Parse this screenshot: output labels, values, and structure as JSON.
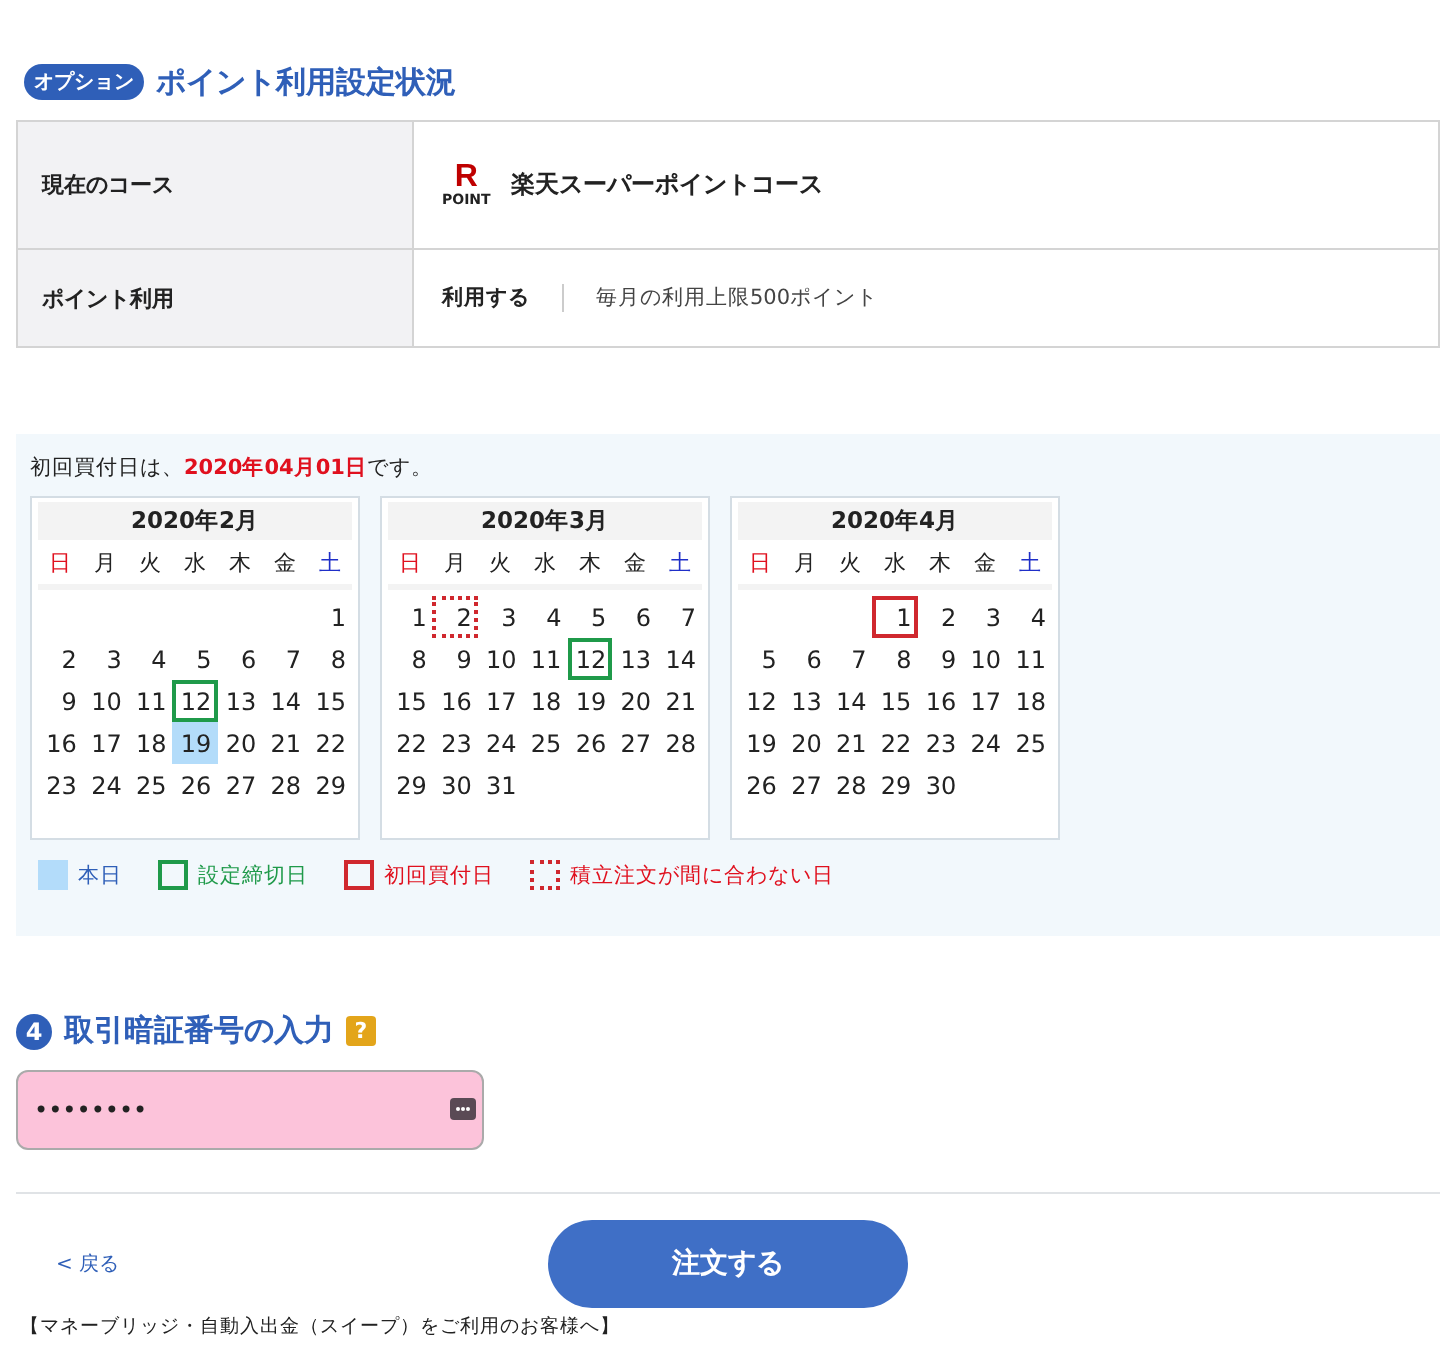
{
  "section_title": {
    "badge": "オプション",
    "title": "ポイント利用設定状況"
  },
  "settings_table": [
    {
      "label": "現在のコース",
      "kind": "course",
      "logo_text": "POINT",
      "logo_letter": "R",
      "value": "楽天スーパーポイントコース"
    },
    {
      "label": "ポイント利用",
      "kind": "usage",
      "value": "利用する",
      "note": "毎月の利用上限500ポイント"
    }
  ],
  "calendar_panel": {
    "intro": "初回買付日は、**2020年04月01日**です。",
    "months": [
      {
        "title": "2020年2月",
        "weekdays": [
          "日",
          "月",
          "火",
          "水",
          "木",
          "金",
          "土"
        ],
        "weeks": [
          [
            "1"
          ],
          [
            "2",
            "3",
            "4",
            "5",
            "6",
            "7",
            "8"
          ],
          [
            "9",
            "10",
            "11",
            {
              "day": "12",
              "kind": "deadline"
            },
            "13",
            "14",
            "15"
          ],
          [
            "16",
            "17",
            "18",
            {
              "day": "19",
              "kind": "today"
            },
            "20",
            "21",
            "22"
          ],
          [
            "23",
            "24",
            "25",
            "26",
            "27",
            "28",
            "29"
          ]
        ]
      },
      {
        "title": "2020年3月",
        "weekdays": [
          "日",
          "月",
          "火",
          "水",
          "木",
          "金",
          "土"
        ],
        "weeks": [
          [
            "1",
            {
              "day": "2",
              "kind": "missed"
            },
            "3",
            "4",
            "5",
            "6",
            "7"
          ],
          [
            "8",
            "9",
            "10",
            "11",
            {
              "day": "12",
              "kind": "deadline"
            },
            "13",
            "14"
          ],
          [
            "15",
            "16",
            "17",
            "18",
            "19",
            "20",
            "21"
          ],
          [
            "22",
            "23",
            "24",
            "25",
            "26",
            "27",
            "28"
          ],
          [
            "29",
            "30",
            "31"
          ]
        ]
      },
      {
        "title": "2020年4月",
        "weekdays": [
          "日",
          "月",
          "火",
          "水",
          "木",
          "金",
          "土"
        ],
        "weeks": [
          [
            {
              "day": "1",
              "kind": "first_buy"
            },
            "2",
            "3",
            "4"
          ],
          [
            "5",
            "6",
            "7",
            "8",
            "9",
            "10",
            "11"
          ],
          [
            "12",
            "13",
            "14",
            "15",
            "16",
            "17",
            "18"
          ],
          [
            "19",
            "20",
            "21",
            "22",
            "23",
            "24",
            "25"
          ],
          [
            "26",
            "27",
            "28",
            "29",
            "30"
          ]
        ]
      }
    ],
    "legend": [
      {
        "kind": "today",
        "label": "本日"
      },
      {
        "kind": "deadline",
        "label": "設定締切日"
      },
      {
        "kind": "first_buy",
        "label": "初回買付日"
      },
      {
        "kind": "missed",
        "label": "積立注文が間に合わない日"
      }
    ]
  },
  "pin_section": {
    "step": "4",
    "title": "取引暗証番号の入力",
    "help": "?",
    "value": "••••••••"
  },
  "back_link": "< 戻る",
  "submit_button": "注文する",
  "footer_note": "【マネーブリッジ・自動入出金（スイープ）をご利用のお客様へ】"
}
